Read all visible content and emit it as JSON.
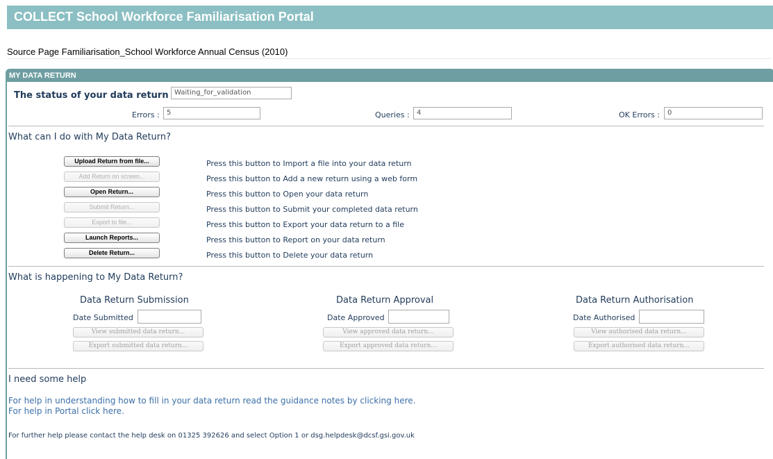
{
  "header": {
    "title": "COLLECT School Workforce Familiarisation Portal"
  },
  "source_page": "Source Page Familiarisation_School Workforce Annual Census (2010)",
  "panel": {
    "title": "MY DATA RETURN",
    "status_label": "The status of your data return :",
    "status_value": "Waiting_for_validation",
    "errors_label": "Errors :",
    "errors_value": "5",
    "queries_label": "Queries :",
    "queries_value": "4",
    "ok_errors_label": "OK Errors :",
    "ok_errors_value": "0"
  },
  "actions": {
    "heading": "What can I do with My Data Return?",
    "items": [
      {
        "label": "Upload Return from file...",
        "desc": "Press this button to Import a file into your data return",
        "enabled": true
      },
      {
        "label": "Add Return on screen...",
        "desc": "Press this button to Add a new return using a web form",
        "enabled": false
      },
      {
        "label": "Open Return...",
        "desc": "Press this button to Open your data return",
        "enabled": true
      },
      {
        "label": "Submit Return...",
        "desc": "Press this button to Submit your completed data return",
        "enabled": false
      },
      {
        "label": "Export to file...",
        "desc": "Press this button to Export your data return to a file",
        "enabled": false
      },
      {
        "label": "Launch Reports...",
        "desc": "Press this button to Report on your data return",
        "enabled": true
      },
      {
        "label": "Delete Return...",
        "desc": "Press this button to Delete your data return",
        "enabled": true
      }
    ]
  },
  "progress": {
    "heading": "What is happening to My Data Return?",
    "columns": [
      {
        "title": "Data Return Submission",
        "date_label": "Date Submitted",
        "date_value": "",
        "view_label": "View submitted data return...",
        "export_label": "Export submitted data return..."
      },
      {
        "title": "Data Return Approval",
        "date_label": "Date Approved",
        "date_value": "",
        "view_label": "View approved data return...",
        "export_label": "Export approved data return..."
      },
      {
        "title": "Data Return Authorisation",
        "date_label": "Date Authorised",
        "date_value": "",
        "view_label": "View authorised data return...",
        "export_label": "Export authorised data return..."
      }
    ]
  },
  "help": {
    "heading": "I need some help",
    "guidance_link": "For help in understanding how to fill in your data return read the guidance notes by clicking here.",
    "portal_link": "For help in Portal click here.",
    "contact": "For further help please contact the help desk on 01325 392626 and select Option 1 or dsg.helpdesk@dcsf.gsi.gov.uk"
  },
  "colors": {
    "banner": "#8bbfc3",
    "panel_header": "#6e9ea2",
    "text": "#1f3a5a",
    "link": "#3b6fa8"
  }
}
